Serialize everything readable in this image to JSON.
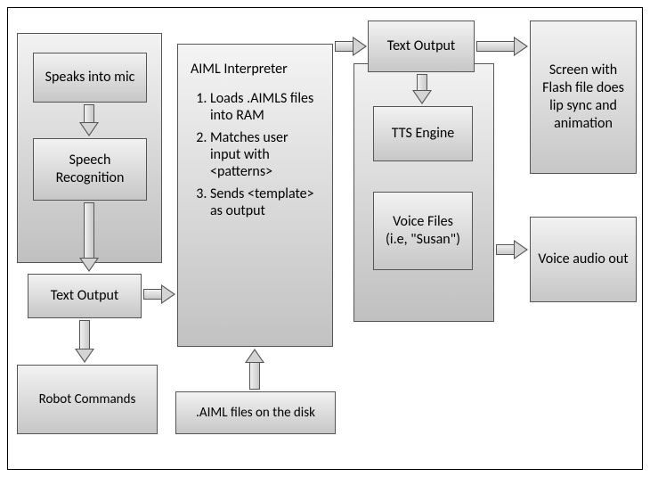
{
  "speaks_into_mic": "Speaks into mic",
  "speech_recognition": "Speech Recognition",
  "text_output_left": "Text Output",
  "robot_commands": "Robot Commands",
  "aiml_files_disk": ".AIML files on the disk",
  "aiml_interpreter": {
    "title": "AIML Interpreter",
    "step1": "Loads .AIMLS files into RAM",
    "step2": "Matches user input with <patterns>",
    "step3": "Sends <template> as output"
  },
  "text_output_right": "Text Output",
  "tts_engine": "TTS Engine",
  "voice_files": "Voice Files (i.e, \"Susan\")",
  "screen_flash": "Screen with Flash file does lip sync and animation",
  "voice_audio_out": "Voice audio out"
}
